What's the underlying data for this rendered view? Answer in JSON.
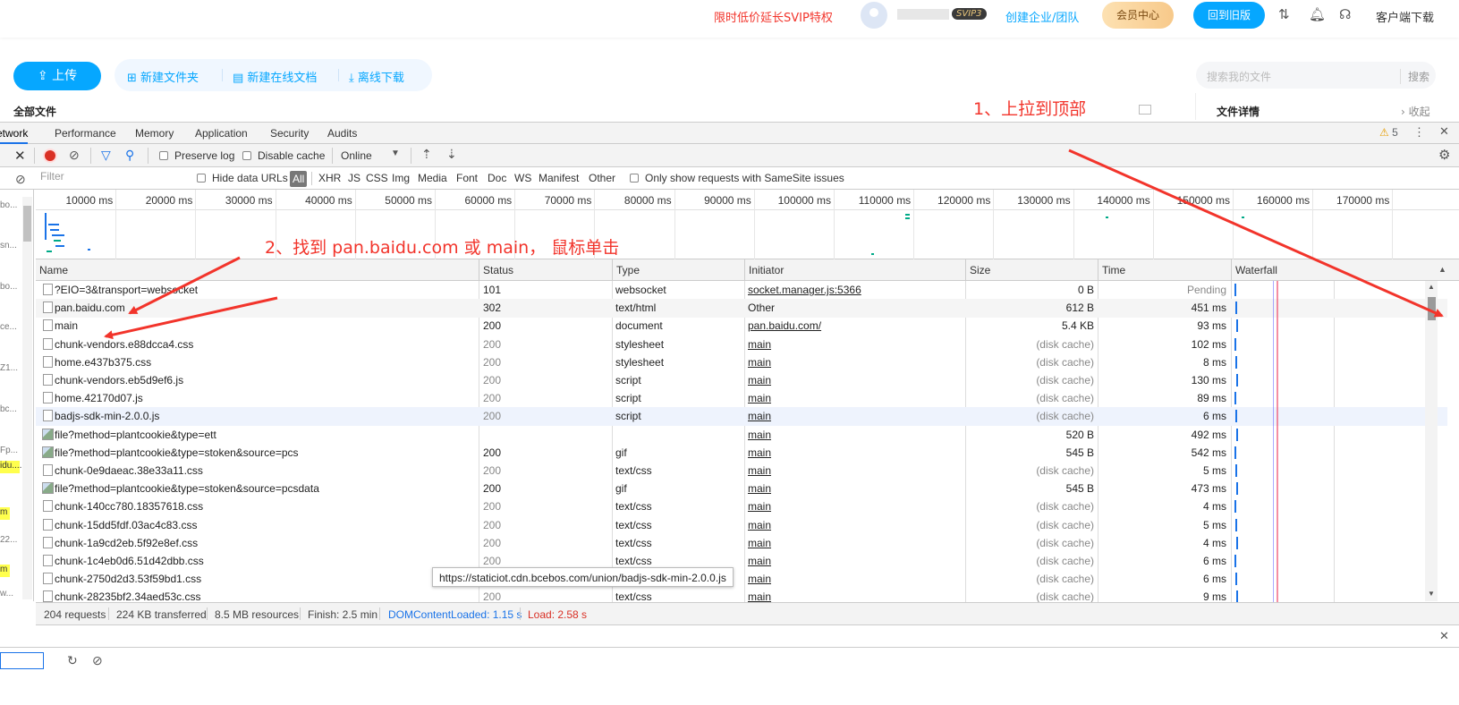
{
  "header": {
    "promo": "限时低价延长SVIP特权",
    "svip_badge": "SVIP3",
    "team": "创建企业/团队",
    "vip_center": "会员中心",
    "old_version": "回到旧版",
    "client_download": "客户端下载"
  },
  "toolbar": {
    "upload": "上传",
    "new_folder": "新建文件夹",
    "new_doc": "新建在线文档",
    "offline": "离线下载",
    "search_placeholder": "搜索我的文件",
    "search_button": "搜索",
    "all_files": "全部文件",
    "file_details": "文件详情",
    "collapse": "收起"
  },
  "annotations": {
    "step1": "1、上拉到顶部",
    "step2": "2、找到 pan.baidu.com 或 main， 鼠标单击"
  },
  "devtools": {
    "tabs": [
      "Network",
      "Performance",
      "Memory",
      "Application",
      "Security",
      "Audits"
    ],
    "active_tab": "Network",
    "warnings": "5",
    "preserve_log": "Preserve log",
    "disable_cache": "Disable cache",
    "throttling": "Online",
    "filter_placeholder": "Filter",
    "hide_data_urls": "Hide data URLs",
    "types": [
      "All",
      "XHR",
      "JS",
      "CSS",
      "Img",
      "Media",
      "Font",
      "Doc",
      "WS",
      "Manifest",
      "Other"
    ],
    "samesite": "Only show requests with SameSite issues",
    "timeline_ticks": [
      "10000 ms",
      "20000 ms",
      "30000 ms",
      "40000 ms",
      "50000 ms",
      "60000 ms",
      "70000 ms",
      "80000 ms",
      "90000 ms",
      "100000 ms",
      "110000 ms",
      "120000 ms",
      "130000 ms",
      "140000 ms",
      "150000 ms",
      "160000 ms",
      "170000 ms"
    ],
    "sidebar_texts": [
      "bo...",
      "sn...",
      "bo...",
      "ce...",
      "Z1...",
      "bc...",
      "Fp...",
      "idu....",
      "m",
      "22...",
      "m",
      "w..."
    ],
    "columns": [
      "Name",
      "Status",
      "Type",
      "Initiator",
      "Size",
      "Time",
      "Waterfall"
    ],
    "rows": [
      {
        "name": "?EIO=3&transport=websocket",
        "status": "101",
        "type": "websocket",
        "initiator": "socket.manager.js:5366",
        "size": "0 B",
        "time": "Pending",
        "icon": "file"
      },
      {
        "name": "pan.baidu.com",
        "status": "302",
        "type": "text/html",
        "initiator": "Other",
        "size": "612 B",
        "time": "451 ms",
        "icon": "file"
      },
      {
        "name": "main",
        "status": "200",
        "type": "document",
        "initiator": "pan.baidu.com/",
        "size": "5.4 KB",
        "time": "93 ms",
        "icon": "file"
      },
      {
        "name": "chunk-vendors.e88dcca4.css",
        "status": "200",
        "type": "stylesheet",
        "initiator": "main",
        "size": "(disk cache)",
        "time": "102 ms",
        "icon": "file"
      },
      {
        "name": "home.e437b375.css",
        "status": "200",
        "type": "stylesheet",
        "initiator": "main",
        "size": "(disk cache)",
        "time": "8 ms",
        "icon": "file"
      },
      {
        "name": "chunk-vendors.eb5d9ef6.js",
        "status": "200",
        "type": "script",
        "initiator": "main",
        "size": "(disk cache)",
        "time": "130 ms",
        "icon": "file"
      },
      {
        "name": "home.42170d07.js",
        "status": "200",
        "type": "script",
        "initiator": "main",
        "size": "(disk cache)",
        "time": "89 ms",
        "icon": "file"
      },
      {
        "name": "badjs-sdk-min-2.0.0.js",
        "status": "200",
        "type": "script",
        "initiator": "main",
        "size": "(disk cache)",
        "time": "6 ms",
        "icon": "file"
      },
      {
        "name": "file?method=plantcookie&type=ett",
        "status": "",
        "type": "",
        "initiator": "main",
        "size": "520 B",
        "time": "492 ms",
        "icon": "img"
      },
      {
        "name": "file?method=plantcookie&type=stoken&source=pcs",
        "status": "200",
        "type": "gif",
        "initiator": "main",
        "size": "545 B",
        "time": "542 ms",
        "icon": "img"
      },
      {
        "name": "chunk-0e9daeac.38e33a11.css",
        "status": "200",
        "type": "text/css",
        "initiator": "main",
        "size": "(disk cache)",
        "time": "5 ms",
        "icon": "file"
      },
      {
        "name": "file?method=plantcookie&type=stoken&source=pcsdata",
        "status": "200",
        "type": "gif",
        "initiator": "main",
        "size": "545 B",
        "time": "473 ms",
        "icon": "img"
      },
      {
        "name": "chunk-140cc780.18357618.css",
        "status": "200",
        "type": "text/css",
        "initiator": "main",
        "size": "(disk cache)",
        "time": "4 ms",
        "icon": "file"
      },
      {
        "name": "chunk-15dd5fdf.03ac4c83.css",
        "status": "200",
        "type": "text/css",
        "initiator": "main",
        "size": "(disk cache)",
        "time": "5 ms",
        "icon": "file"
      },
      {
        "name": "chunk-1a9cd2eb.5f92e8ef.css",
        "status": "200",
        "type": "text/css",
        "initiator": "main",
        "size": "(disk cache)",
        "time": "4 ms",
        "icon": "file"
      },
      {
        "name": "chunk-1c4eb0d6.51d42dbb.css",
        "status": "200",
        "type": "text/css",
        "initiator": "main",
        "size": "(disk cache)",
        "time": "6 ms",
        "icon": "file"
      },
      {
        "name": "chunk-2750d2d3.53f59bd1.css",
        "status": "200",
        "type": "text/css",
        "initiator": "main",
        "size": "(disk cache)",
        "time": "6 ms",
        "icon": "file"
      },
      {
        "name": "chunk-28235bf2.34aed53c.css",
        "status": "200",
        "type": "text/css",
        "initiator": "main",
        "size": "(disk cache)",
        "time": "9 ms",
        "icon": "file"
      }
    ],
    "tooltip": "https://staticiot.cdn.bcebos.com/union/badjs-sdk-min-2.0.0.js",
    "status": {
      "requests": "204 requests",
      "transferred": "224 KB transferred",
      "resources": "8.5 MB resources",
      "finish": "Finish: 2.5 min",
      "dcl": "DOMContentLoaded: 1.15 s",
      "load": "Load: 2.58 s"
    }
  }
}
